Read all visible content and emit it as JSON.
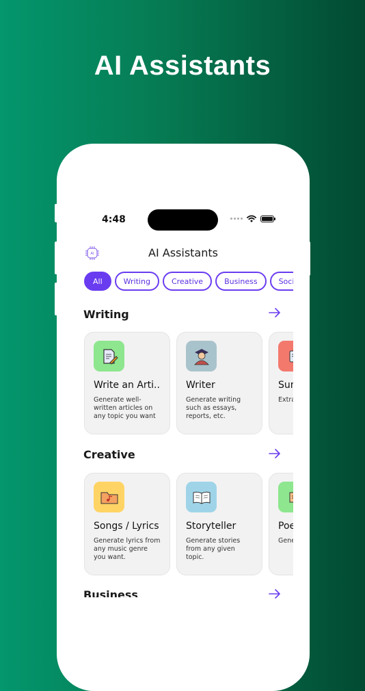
{
  "headline": "AI Assistants",
  "status_bar": {
    "time": "4:48"
  },
  "header": {
    "title": "AI Assistants",
    "logo_label": "AI"
  },
  "chips": [
    {
      "label": "All",
      "active": true
    },
    {
      "label": "Writing",
      "active": false
    },
    {
      "label": "Creative",
      "active": false
    },
    {
      "label": "Business",
      "active": false
    },
    {
      "label": "Social",
      "active": false
    }
  ],
  "sections": [
    {
      "title": "Writing",
      "cards": [
        {
          "title": "Write an Arti...",
          "desc": "Generate well-written articles on any topic you want",
          "icon": "document-pen-icon",
          "color": "#8ee68e"
        },
        {
          "title": "Writer",
          "desc": "Generate writing such as essays, reports, etc.",
          "icon": "graduate-writer-icon",
          "color": "#a9c3cc"
        },
        {
          "title": "Sum",
          "desc": "Extract from",
          "icon": "summary-icon",
          "color": "#f3796d"
        }
      ]
    },
    {
      "title": "Creative",
      "cards": [
        {
          "title": "Songs / Lyrics",
          "desc": "Generate lyrics from any music genre you want.",
          "icon": "music-folder-icon",
          "color": "#ffd465"
        },
        {
          "title": "Storyteller",
          "desc": "Generate stories from any given topic.",
          "icon": "open-book-icon",
          "color": "#9fd4e8"
        },
        {
          "title": "Poe",
          "desc": "Gene differ",
          "icon": "scroll-icon",
          "color": "#8ee68e"
        }
      ]
    },
    {
      "title": "Business",
      "cards": []
    }
  ],
  "colors": {
    "accent": "#6a3cf0",
    "background_start": "#04966d",
    "background_end": "#024a32"
  }
}
